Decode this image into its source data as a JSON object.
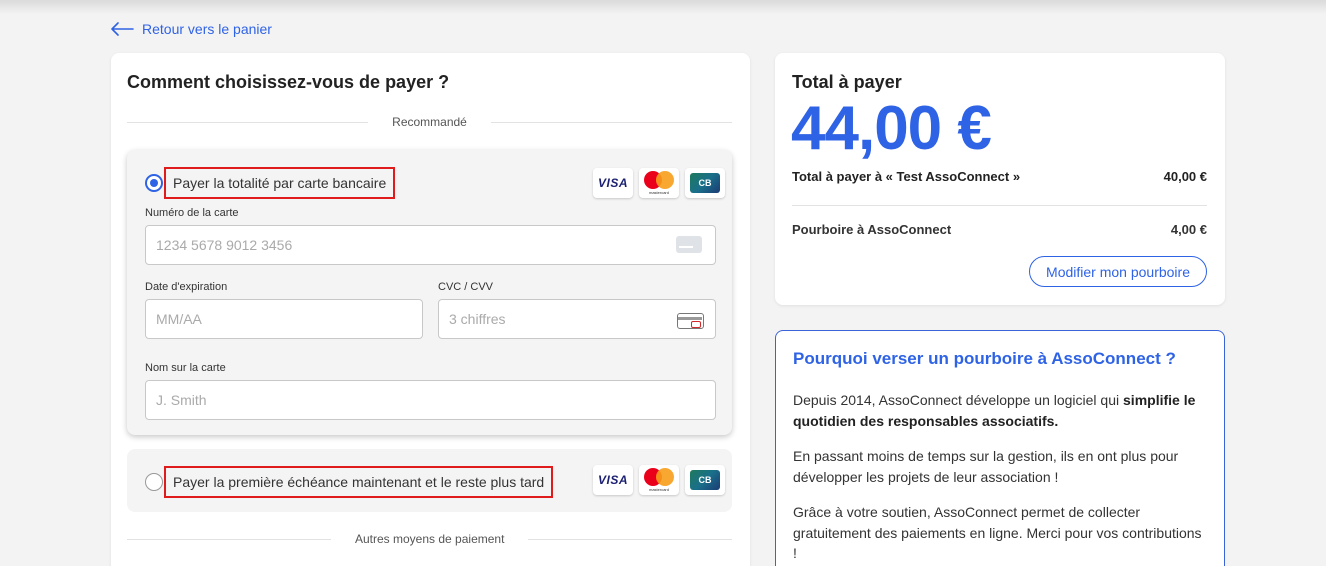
{
  "nav": {
    "back_label": "Retour vers le panier"
  },
  "payment": {
    "title": "Comment choisissez-vous de payer ?",
    "recommended_label": "Recommandé",
    "other_methods_label": "Autres moyens de paiement",
    "option_full": {
      "label": "Payer la totalité par carte bancaire",
      "selected": true,
      "card_number_label": "Numéro de la carte",
      "card_number_placeholder": "1234 5678 9012 3456",
      "expiry_label": "Date d'expiration",
      "expiry_placeholder": "MM/AA",
      "cvc_label": "CVC / CVV",
      "cvc_placeholder": "3 chiffres",
      "name_label": "Nom sur la carte",
      "name_placeholder": "J. Smith"
    },
    "option_installments": {
      "label": "Payer la première échéance maintenant et le reste plus tard",
      "selected": false
    },
    "brands": {
      "visa": "VISA",
      "mastercard": "mastercard",
      "cb": "CB"
    }
  },
  "summary": {
    "title": "Total à payer",
    "total": "44,00 €",
    "line1_label": "Total à payer à « Test AssoConnect »",
    "line1_value": "40,00 €",
    "line2_label": "Pourboire à AssoConnect",
    "line2_value": "4,00 €",
    "modify_button": "Modifier mon pourboire"
  },
  "info": {
    "title": "Pourquoi verser un pourboire à AssoConnect ?",
    "p1_start": "Depuis 2014, AssoConnect développe un logiciel qui ",
    "p1_bold": "simplifie le quotidien des responsables associatifs.",
    "p2": "En passant moins de temps sur la gestion, ils en ont plus pour développer les projets de leur association !",
    "p3": "Grâce à votre soutien, AssoConnect permet de collecter gratuitement des paiements en ligne. Merci pour vos contributions !"
  },
  "colors": {
    "accent": "#2f63e5",
    "highlight_border": "#e01b1b"
  }
}
